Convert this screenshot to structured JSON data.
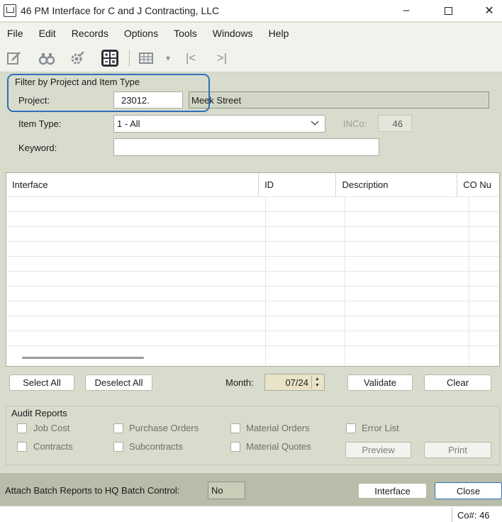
{
  "window": {
    "title": "46 PM Interface for C and J Contracting, LLC",
    "minimize": "–",
    "close": "✕"
  },
  "menu": [
    "File",
    "Edit",
    "Records",
    "Options",
    "Tools",
    "Windows",
    "Help"
  ],
  "toolbar": {
    "icons": [
      "edit-icon",
      "binoculars-icon",
      "settings-icon",
      "calculator-icon",
      "grid-view-icon",
      "dropdown-arrow-icon",
      "first-record-icon",
      "last-record-icon"
    ],
    "dropdown_glyph": "▾",
    "first_glyph": "|<",
    "last_glyph": ">|"
  },
  "filter": {
    "group_label": "Filter by Project and Item Type",
    "project_label": "Project:",
    "project_value": "23012.",
    "project_name": "Meek Street",
    "item_type_label": "Item Type:",
    "item_type_value": "1 - All",
    "inco_label": "INCo:",
    "inco_value": "46",
    "keyword_label": "Keyword:",
    "keyword_value": ""
  },
  "grid": {
    "columns": [
      "Interface",
      "ID",
      "Description",
      "CO Nu"
    ],
    "rows": []
  },
  "actions": {
    "select_all": "Select All",
    "deselect_all": "Deselect All",
    "month_label": "Month:",
    "month_value": "07/24",
    "validate": "Validate",
    "clear": "Clear"
  },
  "audit": {
    "group_label": "Audit Reports",
    "job_cost": "Job Cost",
    "purchase_orders": "Purchase Orders",
    "material_orders": "Material Orders",
    "error_list": "Error List",
    "contracts": "Contracts",
    "subcontracts": "Subcontracts",
    "material_quotes": "Material Quotes",
    "preview": "Preview",
    "print": "Print"
  },
  "bottom": {
    "attach_label": "Attach Batch Reports to HQ Batch Control:",
    "attach_value": "No",
    "interface": "Interface",
    "close": "Close"
  },
  "status": {
    "company": "Co#: 46"
  }
}
